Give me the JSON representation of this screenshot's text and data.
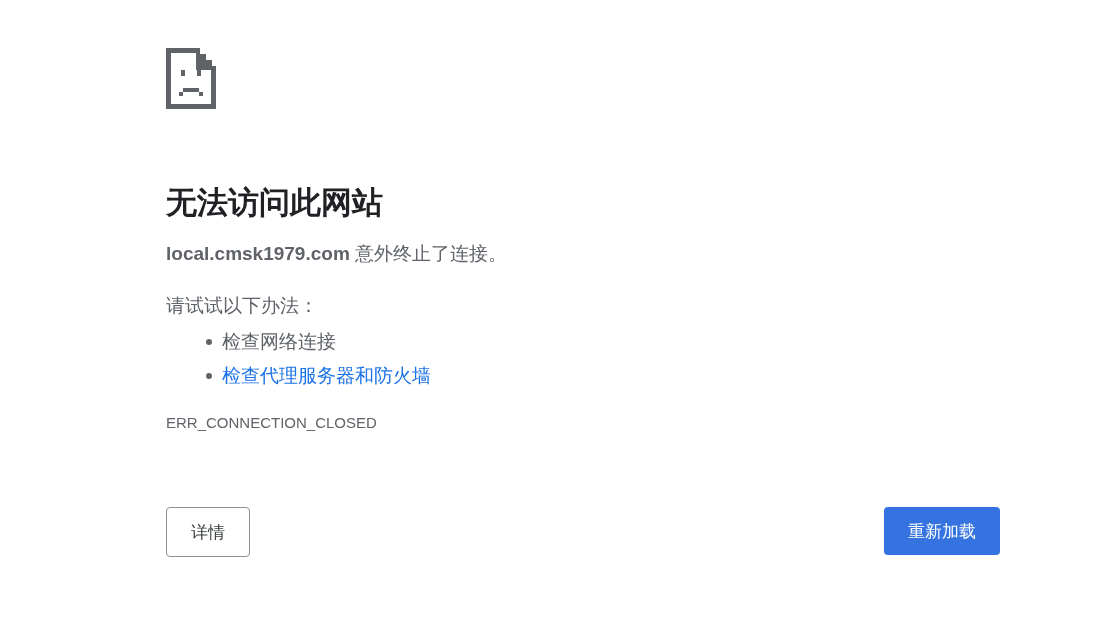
{
  "heading": "无法访问此网站",
  "message": "**local.cmsk1979.com** 意外终止了连接。",
  "suggestions_label": "请试试以下办法：",
  "suggestions": [
    {
      "text": "检查网络连接",
      "kind": "text"
    },
    {
      "text": "检查代理服务器和防火墙",
      "kind": "link"
    }
  ],
  "error_code": "ERR_CONNECTION_CLOSED",
  "buttons": [
    {
      "label": "详情",
      "kind": "secondary"
    },
    {
      "label": "重新加载",
      "kind": "primary"
    }
  ]
}
